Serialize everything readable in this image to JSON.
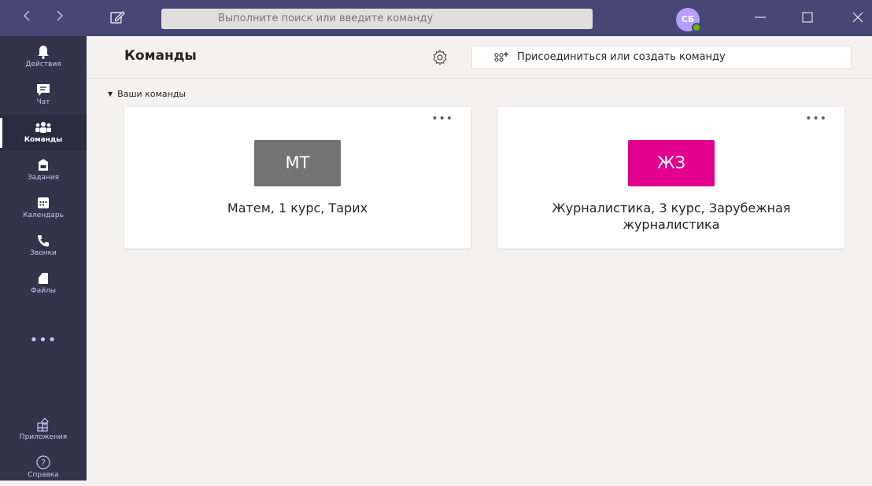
{
  "topbar": {
    "back_icon": "chevron-left-icon",
    "forward_icon": "chevron-right-icon",
    "compose_icon": "compose-icon",
    "search_placeholder": "Выполните поиск или введите команду",
    "avatar_initials": "СБ",
    "presence": "available"
  },
  "rail": {
    "items": [
      {
        "label": "Действия",
        "icon": "bell-icon"
      },
      {
        "label": "Чат",
        "icon": "chat-icon"
      },
      {
        "label": "Команды",
        "icon": "teams-icon",
        "active": true
      },
      {
        "label": "Задания",
        "icon": "assignments-icon"
      },
      {
        "label": "Календарь",
        "icon": "calendar-icon"
      },
      {
        "label": "Звонки",
        "icon": "phone-icon"
      },
      {
        "label": "Файлы",
        "icon": "file-icon"
      }
    ],
    "more_label": "•••",
    "apps_label": "Приложения",
    "help_label": "Справка"
  },
  "main": {
    "title": "Команды",
    "join_label": "Присоединиться или создать команду",
    "section_label": "Ваши команды",
    "teams": [
      {
        "initials": "МТ",
        "name": "Матем, 1 курс, Тарих",
        "color": "#737373"
      },
      {
        "initials": "ЖЗ",
        "name": "Журналистика, 3 курс, Зарубежная журналистика",
        "color": "#e3008c"
      }
    ],
    "more_label": "•••"
  },
  "colors": {
    "topbar": "#464775",
    "rail": "#33344a",
    "background": "#f3f2f1"
  }
}
